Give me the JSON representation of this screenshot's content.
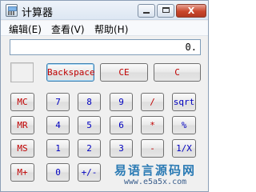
{
  "window": {
    "title": "计算器",
    "icon": "calculator-icon",
    "controls": {
      "minimize": "minimize-icon",
      "maximize": "maximize-icon",
      "close_label": "X"
    }
  },
  "menu": {
    "edit": "编辑(E)",
    "view": "查看(V)",
    "help": "帮助(H)"
  },
  "display": {
    "value": "0."
  },
  "top_keys": {
    "backspace": "Backspace",
    "ce": "CE",
    "c": "C"
  },
  "memory_keys": {
    "mc": "MC",
    "mr": "MR",
    "ms": "MS",
    "mplus": "M+"
  },
  "keypad": {
    "row1": [
      "7",
      "8",
      "9",
      "/",
      "sqrt"
    ],
    "row2": [
      "4",
      "5",
      "6",
      "*",
      "%"
    ],
    "row3": [
      "1",
      "2",
      "3",
      "-",
      "1/X"
    ],
    "row4": [
      "0",
      "+/-",
      ".",
      "+",
      "="
    ]
  },
  "watermark": {
    "cn": "易语言源码网",
    "url": "www.e5a5x.com"
  },
  "colors": {
    "red_key": "#c00000",
    "blue_key": "#0000c0",
    "watermark": "#2a7ab4"
  }
}
